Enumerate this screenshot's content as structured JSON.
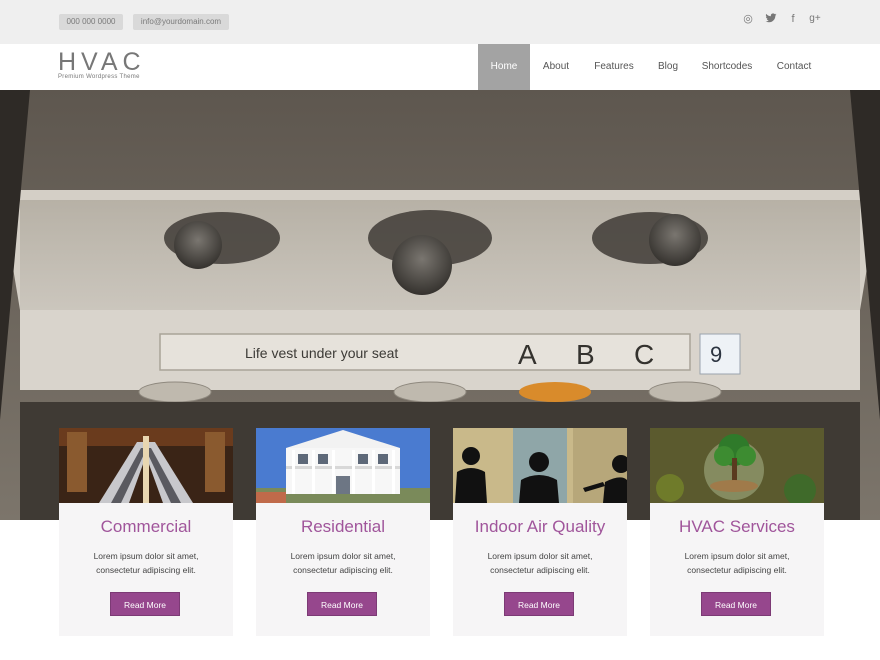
{
  "topbar": {
    "phone": "000 000 0000",
    "email": "info@yourdomain.com",
    "social": [
      {
        "icon": "dribbble-icon",
        "glyph": "◎"
      },
      {
        "icon": "twitter-icon",
        "glyph": "🐦"
      },
      {
        "icon": "facebook-icon",
        "glyph": "f"
      },
      {
        "icon": "google-plus-icon",
        "glyph": "g+"
      }
    ]
  },
  "header": {
    "logo_title": "HVAC",
    "logo_tagline": "Premium Wordpress Theme",
    "nav": [
      "Home",
      "About",
      "Features",
      "Blog",
      "Shortcodes",
      "Contact"
    ],
    "active_nav": "Home"
  },
  "hero": {
    "sign_text": "Life vest under your seat",
    "seat_letters": [
      "A",
      "B",
      "C"
    ],
    "row_number": "9"
  },
  "cards": [
    {
      "title": "Commercial",
      "text": "Lorem ipsum dolor sit amet, consectetur adipiscing elit.",
      "button": "Read More"
    },
    {
      "title": "Residential",
      "text": "Lorem ipsum dolor sit amet, consectetur adipiscing elit.",
      "button": "Read More"
    },
    {
      "title": "Indoor Air Quality",
      "text": "Lorem ipsum dolor sit amet, consectetur adipiscing elit.",
      "button": "Read More"
    },
    {
      "title": "HVAC Services",
      "text": "Lorem ipsum dolor sit amet, consectetur adipiscing elit.",
      "button": "Read More"
    }
  ],
  "colors": {
    "accent": "#96478d",
    "accent_text": "#a0559b",
    "active_nav_bg": "#a3a3a3",
    "topbar_bg": "#efefef"
  }
}
